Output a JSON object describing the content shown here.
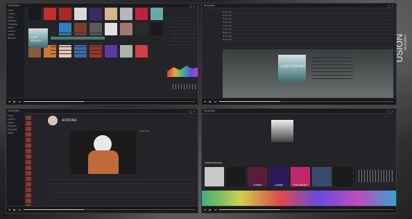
{
  "brand": {
    "word": "USION",
    "sub": "MusicBee"
  },
  "win1": {
    "title": "MusicBee",
    "side": [
      "Music",
      "Library",
      "Inbox",
      "Playlists",
      "Podcasts",
      "Radio",
      "Genres",
      "Artists",
      "Albums"
    ],
    "covers": [
      "#1a1a1a",
      "#c92a2a",
      "#b02525",
      "#d8d8d8",
      "#3a2a6a",
      "#d9b58a",
      "#b8b8b8",
      "#c0203a",
      "#6aa8a6",
      "#2f7fc0",
      "#7a3f2a",
      "#5a5a5a",
      "#e0e0e0",
      "#a07a6a",
      "#2a2a2a",
      "#1a1a1a",
      "#8a5a3a",
      "#c97a2a",
      "#e8c8b8",
      "#3a6ab0",
      "#a03030",
      "#5a3aa0",
      "#b0b0b0",
      "#d04040"
    ],
    "album": "LAST YOUNG"
  },
  "win2": {
    "title": "MusicBee",
    "album": "LAST YOUNG",
    "tracks": [
      "Track 01",
      "Track 02",
      "Track 03",
      "Track 04",
      "Track 05",
      "Track 06",
      "Track 07",
      "Track 08",
      "Track 09"
    ]
  },
  "win3": {
    "title": "MusicBee",
    "artist": "AURORA",
    "about": "Artist info",
    "side": [
      "Music",
      "Library",
      "Inbox",
      "Playlists",
      "Podcasts",
      "Radio"
    ]
  },
  "win4": {
    "title": "MusicBee",
    "section": "Latest Albums",
    "albums": [
      {
        "c": "#c8c8c8",
        "t": ""
      },
      {
        "c": "#1a1a1a",
        "t": ""
      },
      {
        "c": "#5a1a3a",
        "t": "LOREEN"
      },
      {
        "c": "#2a1a5a",
        "t": "LOREEN"
      },
      {
        "c": "#c0286a",
        "t": "THE REMIXES"
      },
      {
        "c": "#3a4a6a",
        "t": ""
      },
      {
        "c": "#1a1a1a",
        "t": ""
      }
    ]
  },
  "player": {
    "prev": "⏮",
    "play": "▶",
    "next": "⏭"
  }
}
